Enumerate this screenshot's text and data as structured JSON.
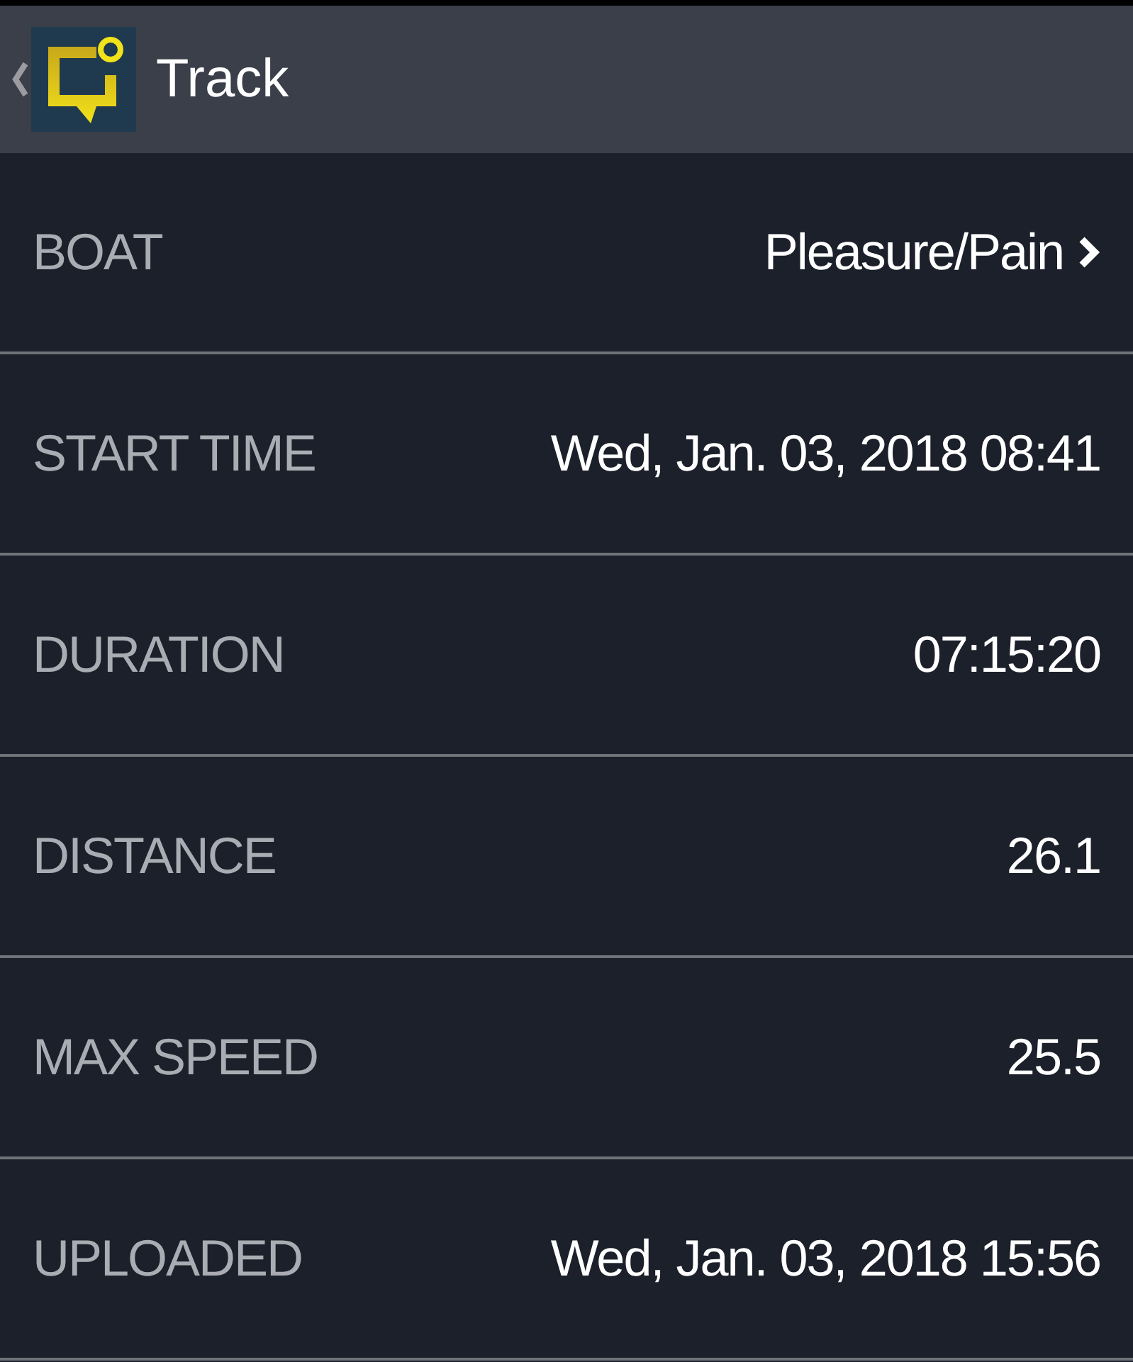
{
  "header": {
    "title": "Track"
  },
  "rows": [
    {
      "label": "BOAT",
      "value": "Pleasure/Pain",
      "kind": "link"
    },
    {
      "label": "START TIME",
      "value": "Wed, Jan. 03, 2018 08:41",
      "kind": "plain"
    },
    {
      "label": "DURATION",
      "value": "07:15:20",
      "kind": "plain"
    },
    {
      "label": "DISTANCE",
      "value": "26.1",
      "kind": "plain"
    },
    {
      "label": "MAX SPEED",
      "value": "25.5",
      "kind": "plain"
    },
    {
      "label": "UPLOADED",
      "value": "Wed, Jan. 03, 2018 15:56",
      "kind": "plain"
    }
  ]
}
